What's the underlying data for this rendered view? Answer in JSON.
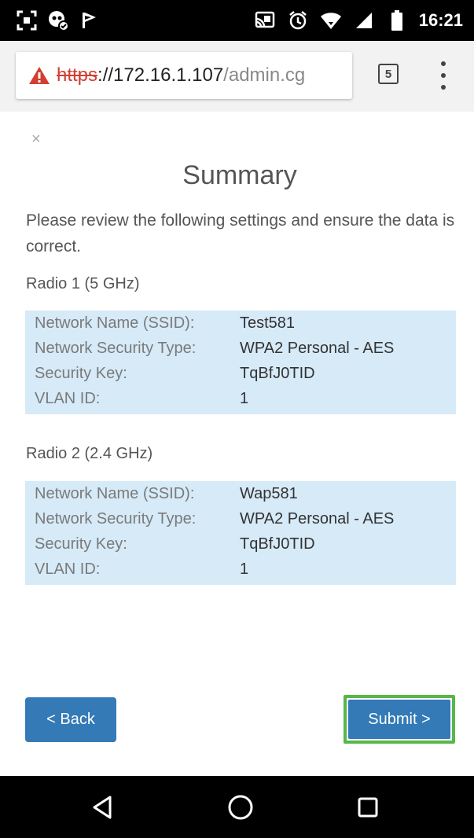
{
  "status_bar": {
    "time": "16:21",
    "icons": [
      "screen-frame-icon",
      "visitor-icon",
      "forward-flag-icon",
      "cast-icon",
      "alarm-icon",
      "wifi-icon",
      "signal-icon",
      "battery-icon"
    ]
  },
  "browser": {
    "url_scheme": "https",
    "url_host": "://172.16.1.107",
    "url_path": "/admin.cg",
    "tab_count": "5",
    "warning_color": "#d23f31"
  },
  "dialog": {
    "close_label": "×",
    "title": "Summary",
    "intro": "Please review the following settings and ensure the data is correct.",
    "radios": [
      {
        "label": "Radio 1 (5 GHz)",
        "rows": [
          {
            "label": "Network Name (SSID):",
            "value": "Test581"
          },
          {
            "label": "Network Security Type:",
            "value": "WPA2 Personal - AES"
          },
          {
            "label": "Security Key:",
            "value": "TqBfJ0TID"
          },
          {
            "label": "VLAN ID:",
            "value": "1"
          }
        ]
      },
      {
        "label": "Radio 2 (2.4 GHz)",
        "rows": [
          {
            "label": "Network Name (SSID):",
            "value": "Wap581"
          },
          {
            "label": "Network Security Type:",
            "value": "WPA2 Personal - AES"
          },
          {
            "label": "Security Key:",
            "value": "TqBfJ0TID"
          },
          {
            "label": "VLAN ID:",
            "value": "1"
          }
        ]
      }
    ],
    "back_label": "< Back",
    "submit_label": "Submit >",
    "button_color": "#337ab7",
    "highlight_color": "#55b848"
  },
  "nav_bar": {
    "icons": [
      "back-triangle-icon",
      "home-circle-icon",
      "recents-square-icon"
    ]
  }
}
